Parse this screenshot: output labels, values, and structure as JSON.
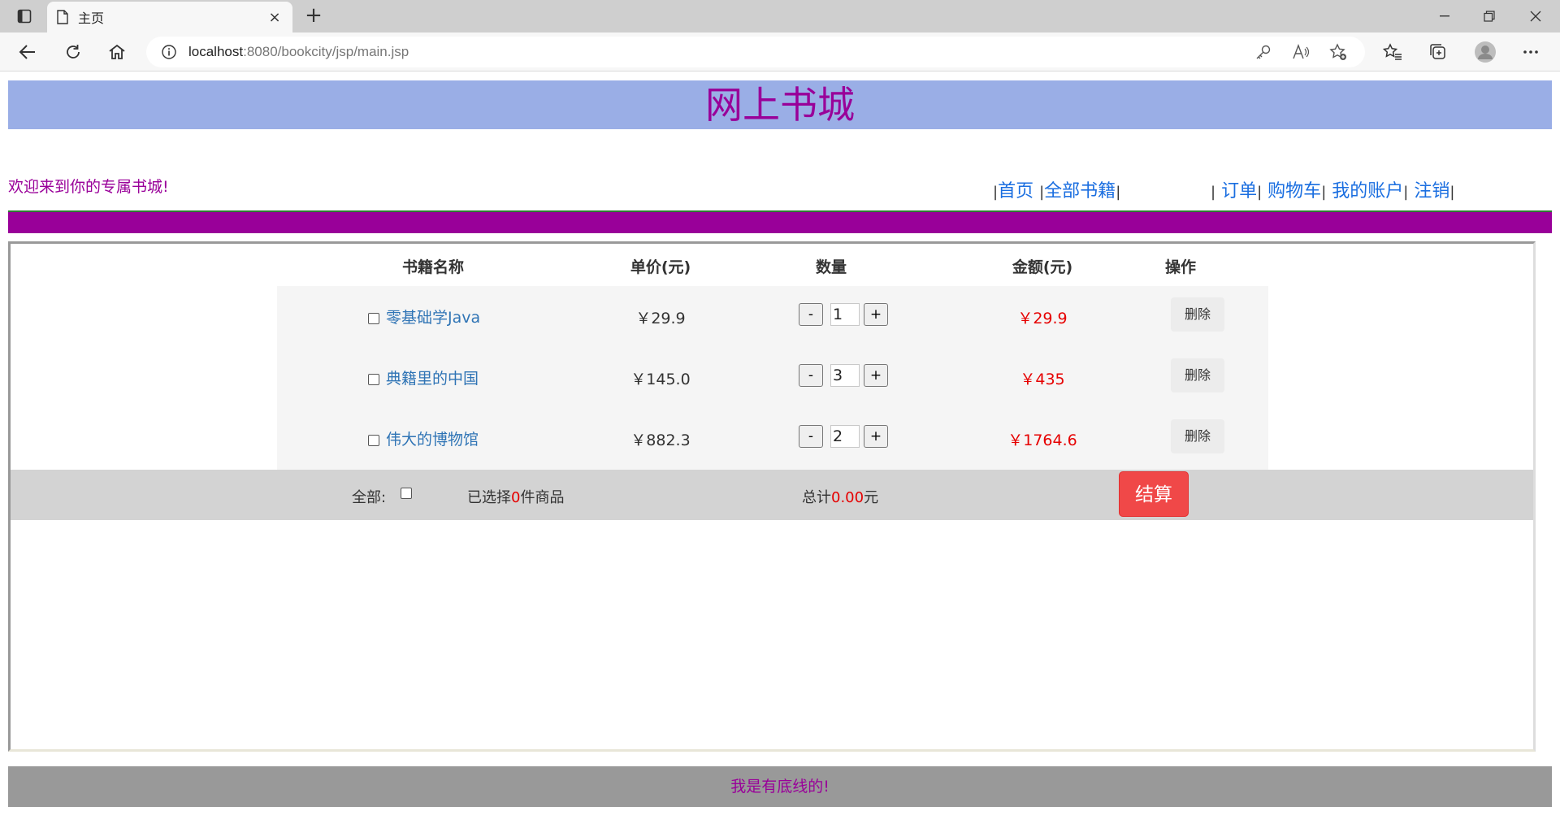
{
  "browser": {
    "tab_title": "主页",
    "url_host": "localhost",
    "url_rest": ":8080/bookcity/jsp/main.jsp",
    "new_tab": "+",
    "close": "×"
  },
  "site": {
    "banner_title": "网上书城",
    "welcome": "欢迎来到你的专属书城!",
    "nav_left": [
      "首页",
      "全部书籍"
    ],
    "nav_right": [
      "订单",
      "购物车",
      "我的账户",
      "注销"
    ],
    "sep": "|"
  },
  "cart": {
    "headers": [
      "书籍名称",
      "单价(元)",
      "数量",
      "金额(元)",
      "操作"
    ],
    "items": [
      {
        "name": "零基础学Java",
        "price": "￥29.9",
        "qty": "1",
        "amount": "￥29.9",
        "action": "删除"
      },
      {
        "name": "典籍里的中国",
        "price": "￥145.0",
        "qty": "3",
        "amount": "￥435",
        "action": "删除"
      },
      {
        "name": "伟大的博物馆",
        "price": "￥882.3",
        "qty": "2",
        "amount": "￥1764.6",
        "action": "删除"
      }
    ],
    "minus": "-",
    "plus": "+",
    "select_all_label": "全部:",
    "selected_prefix": "已选择",
    "selected_count": "0",
    "selected_suffix": "件商品",
    "total_prefix": "总计",
    "total_value": "0.00",
    "total_suffix": "元",
    "checkout": "结算"
  },
  "footer": {
    "text": "我是有底线的!"
  },
  "colors": {
    "banner_bg": "#9aaee6",
    "brand_purple": "#990099",
    "link_blue": "#1a6ee0",
    "price_red": "#e60000",
    "checkout_red": "#f04848"
  }
}
